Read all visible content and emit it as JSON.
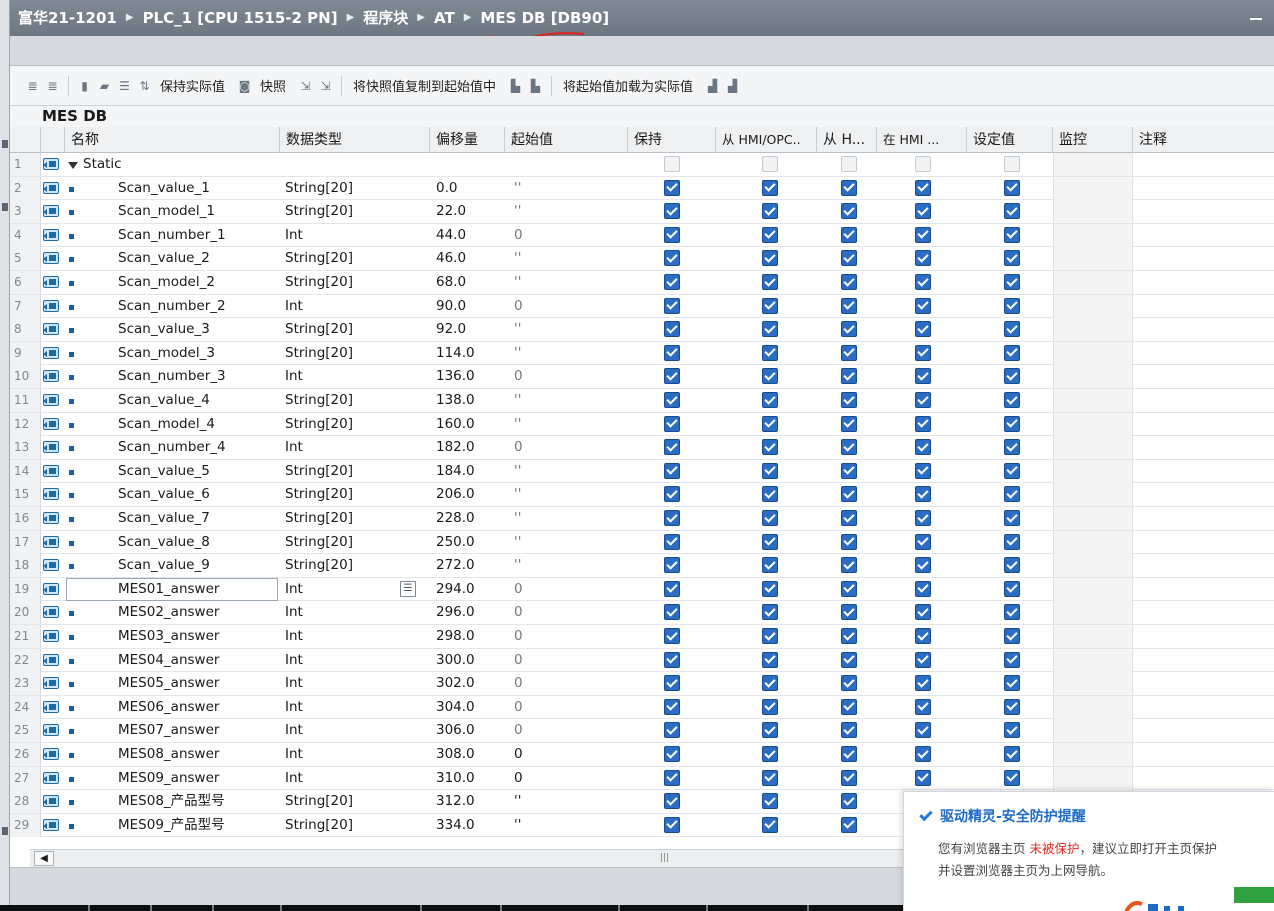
{
  "titlebar": {
    "crumbs": [
      "富华21-1201",
      "PLC_1 [CPU 1515-2 PN]",
      "程序块",
      "AT",
      "MES DB [DB90]"
    ],
    "separator_icon": "triangle-right-icon"
  },
  "toolbar": {
    "buttons": [
      {
        "icon": "insert-row-icon"
      },
      {
        "icon": "add-row-icon"
      },
      {
        "icon": "expand-icon"
      },
      {
        "icon": "collapse-icon"
      },
      {
        "icon": "tree-view-icon"
      },
      {
        "icon": "reset-start-values-icon"
      },
      {
        "label": "保持实际值",
        "icon": "keep-actual-icon"
      },
      {
        "label": "快照",
        "icon": "snapshot-icon"
      },
      {
        "icon": "copy-snapshot-icon"
      },
      {
        "label": "将快照值复制到起始值中",
        "icon": "load-icon"
      },
      {
        "label": "将起始值加载为实际值",
        "icon": "load-actual-icon"
      }
    ]
  },
  "db_title": "MES DB",
  "table": {
    "columns": [
      "名称",
      "数据类型",
      "偏移量",
      "起始值",
      "保持",
      "从 HMI/OPC..",
      "从 H...",
      "在 HMI ...",
      "设定值",
      "监控",
      "注释"
    ],
    "static_row": {
      "num": "1",
      "name": "Static"
    },
    "rows": [
      {
        "num": "2",
        "name": "Scan_value_1",
        "type": "String[20]",
        "offset": "0.0",
        "start": "''"
      },
      {
        "num": "3",
        "name": "Scan_model_1",
        "type": "String[20]",
        "offset": "22.0",
        "start": "''"
      },
      {
        "num": "4",
        "name": "Scan_number_1",
        "type": "Int",
        "offset": "44.0",
        "start": "0"
      },
      {
        "num": "5",
        "name": "Scan_value_2",
        "type": "String[20]",
        "offset": "46.0",
        "start": "''"
      },
      {
        "num": "6",
        "name": "Scan_model_2",
        "type": "String[20]",
        "offset": "68.0",
        "start": "''"
      },
      {
        "num": "7",
        "name": "Scan_number_2",
        "type": "Int",
        "offset": "90.0",
        "start": "0"
      },
      {
        "num": "8",
        "name": "Scan_value_3",
        "type": "String[20]",
        "offset": "92.0",
        "start": "''"
      },
      {
        "num": "9",
        "name": "Scan_model_3",
        "type": "String[20]",
        "offset": "114.0",
        "start": "''"
      },
      {
        "num": "10",
        "name": "Scan_number_3",
        "type": "Int",
        "offset": "136.0",
        "start": "0"
      },
      {
        "num": "11",
        "name": "Scan_value_4",
        "type": "String[20]",
        "offset": "138.0",
        "start": "''"
      },
      {
        "num": "12",
        "name": "Scan_model_4",
        "type": "String[20]",
        "offset": "160.0",
        "start": "''"
      },
      {
        "num": "13",
        "name": "Scan_number_4",
        "type": "Int",
        "offset": "182.0",
        "start": "0"
      },
      {
        "num": "14",
        "name": "Scan_value_5",
        "type": "String[20]",
        "offset": "184.0",
        "start": "''"
      },
      {
        "num": "15",
        "name": "Scan_value_6",
        "type": "String[20]",
        "offset": "206.0",
        "start": "''"
      },
      {
        "num": "16",
        "name": "Scan_value_7",
        "type": "String[20]",
        "offset": "228.0",
        "start": "''"
      },
      {
        "num": "17",
        "name": "Scan_value_8",
        "type": "String[20]",
        "offset": "250.0",
        "start": "''"
      },
      {
        "num": "18",
        "name": "Scan_value_9",
        "type": "String[20]",
        "offset": "272.0",
        "start": "''"
      },
      {
        "num": "19",
        "name": "MES01_answer",
        "type": "Int",
        "offset": "294.0",
        "start": "0"
      },
      {
        "num": "20",
        "name": "MES02_answer",
        "type": "Int",
        "offset": "296.0",
        "start": "0"
      },
      {
        "num": "21",
        "name": "MES03_answer",
        "type": "Int",
        "offset": "298.0",
        "start": "0"
      },
      {
        "num": "22",
        "name": "MES04_answer",
        "type": "Int",
        "offset": "300.0",
        "start": "0"
      },
      {
        "num": "23",
        "name": "MES05_answer",
        "type": "Int",
        "offset": "302.0",
        "start": "0"
      },
      {
        "num": "24",
        "name": "MES06_answer",
        "type": "Int",
        "offset": "304.0",
        "start": "0"
      },
      {
        "num": "25",
        "name": "MES07_answer",
        "type": "Int",
        "offset": "306.0",
        "start": "0"
      },
      {
        "num": "26",
        "name": "MES08_answer",
        "type": "Int",
        "offset": "308.0",
        "start": "0"
      },
      {
        "num": "27",
        "name": "MES09_answer",
        "type": "Int",
        "offset": "310.0",
        "start": "0"
      },
      {
        "num": "28",
        "name": "MES08_产品型号",
        "type": "String[20]",
        "offset": "312.0",
        "start": "''"
      },
      {
        "num": "29",
        "name": "MES09_产品型号",
        "type": "String[20]",
        "offset": "334.0",
        "start": "''"
      }
    ],
    "selected_row": "19"
  },
  "popup": {
    "title": "驱动精灵-安全防护提醒",
    "line1_prefix": "您有浏览器主页",
    "line1_warn": "未被保护",
    "line1_suffix": "，建议立即打开主页保护",
    "line2": "并设置浏览器主页为上网导航。"
  },
  "colors": {
    "titlebar": "#76818c",
    "checkbox_on": "#2a6dc3",
    "popup_title": "#1e6bc5",
    "warning": "#e12b20"
  }
}
